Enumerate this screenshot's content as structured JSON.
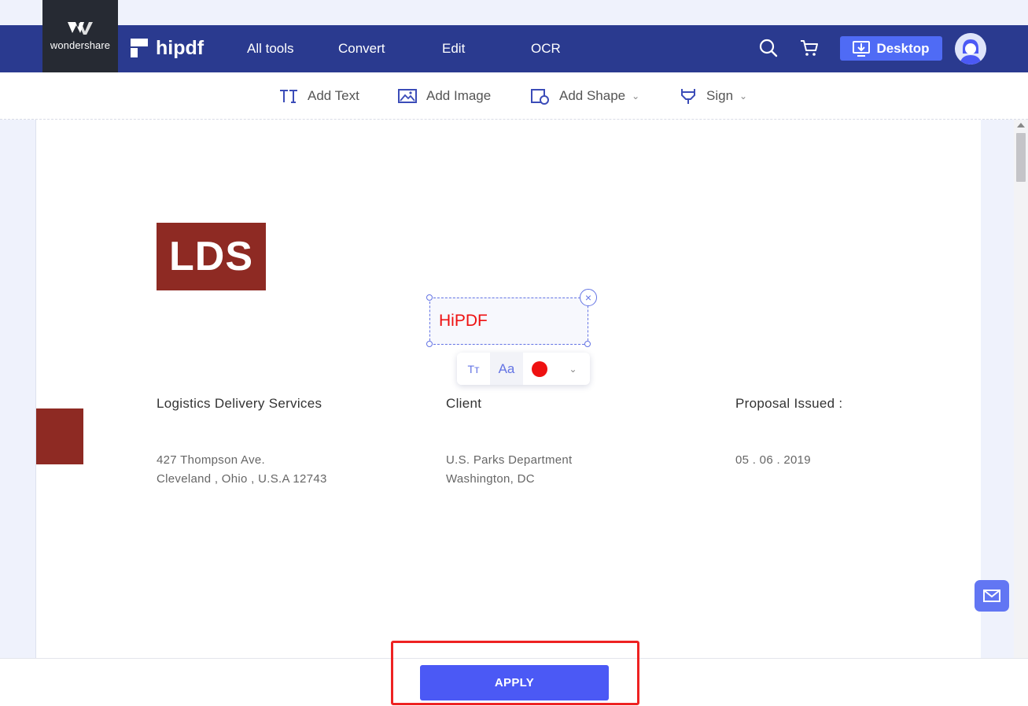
{
  "brand": {
    "wondershare": "wondershare",
    "hipdf": "hipdf"
  },
  "nav": {
    "items": [
      "All tools",
      "Convert",
      "Edit",
      "OCR"
    ],
    "desktop_label": "Desktop"
  },
  "toolbar": {
    "add_text": "Add Text",
    "add_image": "Add Image",
    "add_shape": "Add Shape",
    "sign": "Sign",
    "caret": "⌄"
  },
  "document": {
    "logo_text": "LDS",
    "col1": {
      "heading": "Logistics Delivery Services",
      "line1": "427 Thompson Ave.",
      "line2": "Cleveland , Ohio , U.S.A 12743"
    },
    "col2": {
      "heading": "Client",
      "line1": "U.S. Parks Department",
      "line2": "Washington, DC"
    },
    "col3": {
      "heading": "Proposal Issued :",
      "line1": "05 . 06 . 2019"
    }
  },
  "annotation": {
    "text": "HiPDF",
    "close": "×",
    "text_color": "#ee1111",
    "font_label": "Aa",
    "size_label": "Tт",
    "more": "⌄"
  },
  "footer": {
    "apply_label": "APPLY"
  },
  "colors": {
    "nav_bg": "#2a3a8f",
    "accent": "#4b59f5",
    "logo_red": "#8e2a23",
    "highlight": "#ee2222"
  }
}
